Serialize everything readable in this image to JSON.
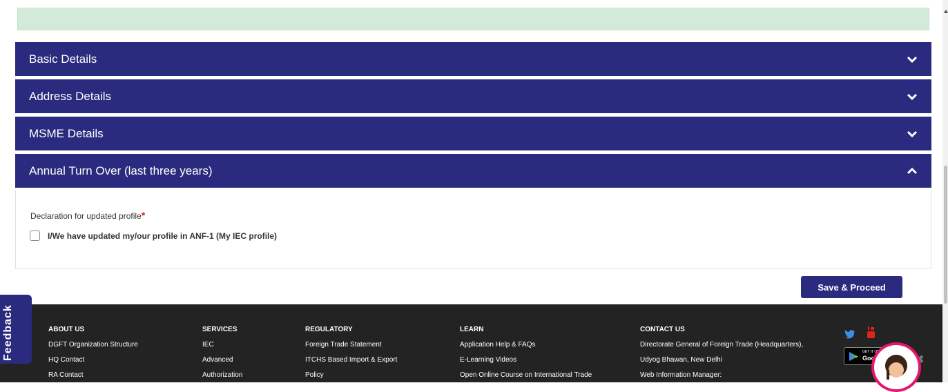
{
  "accordion": {
    "sections": [
      {
        "label": "Basic Details",
        "state": "collapsed"
      },
      {
        "label": "Address Details",
        "state": "collapsed"
      },
      {
        "label": "MSME Details",
        "state": "collapsed"
      },
      {
        "label": "Annual Turn Over (last three years)",
        "state": "expanded"
      }
    ]
  },
  "declaration": {
    "label": "Declaration for updated profile",
    "required_mark": "*",
    "checkbox_label": "I/We have updated my/our profile in ANF-1 (My IEC profile)",
    "checked": false
  },
  "actions": {
    "save_label": "Save & Proceed"
  },
  "feedback_tab": {
    "label": "Feedback"
  },
  "footer": {
    "columns": [
      {
        "heading": "ABOUT US",
        "links": [
          "DGFT Organization Structure",
          "HQ Contact",
          "RA Contact"
        ]
      },
      {
        "heading": "SERVICES",
        "links": [
          "IEC",
          "Advanced",
          "Authorization"
        ]
      },
      {
        "heading": "REGULATORY",
        "links": [
          "Foreign Trade Statement",
          "ITCHS Based Import & Export",
          "Policy"
        ]
      },
      {
        "heading": "LEARN",
        "links": [
          "Application Help & FAQs",
          "E-Learning Videos",
          "Open Online Course on International Trade"
        ]
      },
      {
        "heading": "CONTACT US",
        "links": [
          "Directorate General of Foreign Trade (Headquarters),",
          "Udyog Bhawan, New Delhi",
          "Web Information Manager:"
        ]
      }
    ],
    "social_icons": [
      "twitter-icon",
      "youtube-icon"
    ],
    "store_badge": {
      "small_text": "GET IT ON",
      "big_text": "Google Play"
    }
  },
  "colors": {
    "accordion_header": "#2a2a7e",
    "footer_bg": "#232323",
    "notice_bg": "#d4ead9",
    "required": "#e0231c"
  }
}
